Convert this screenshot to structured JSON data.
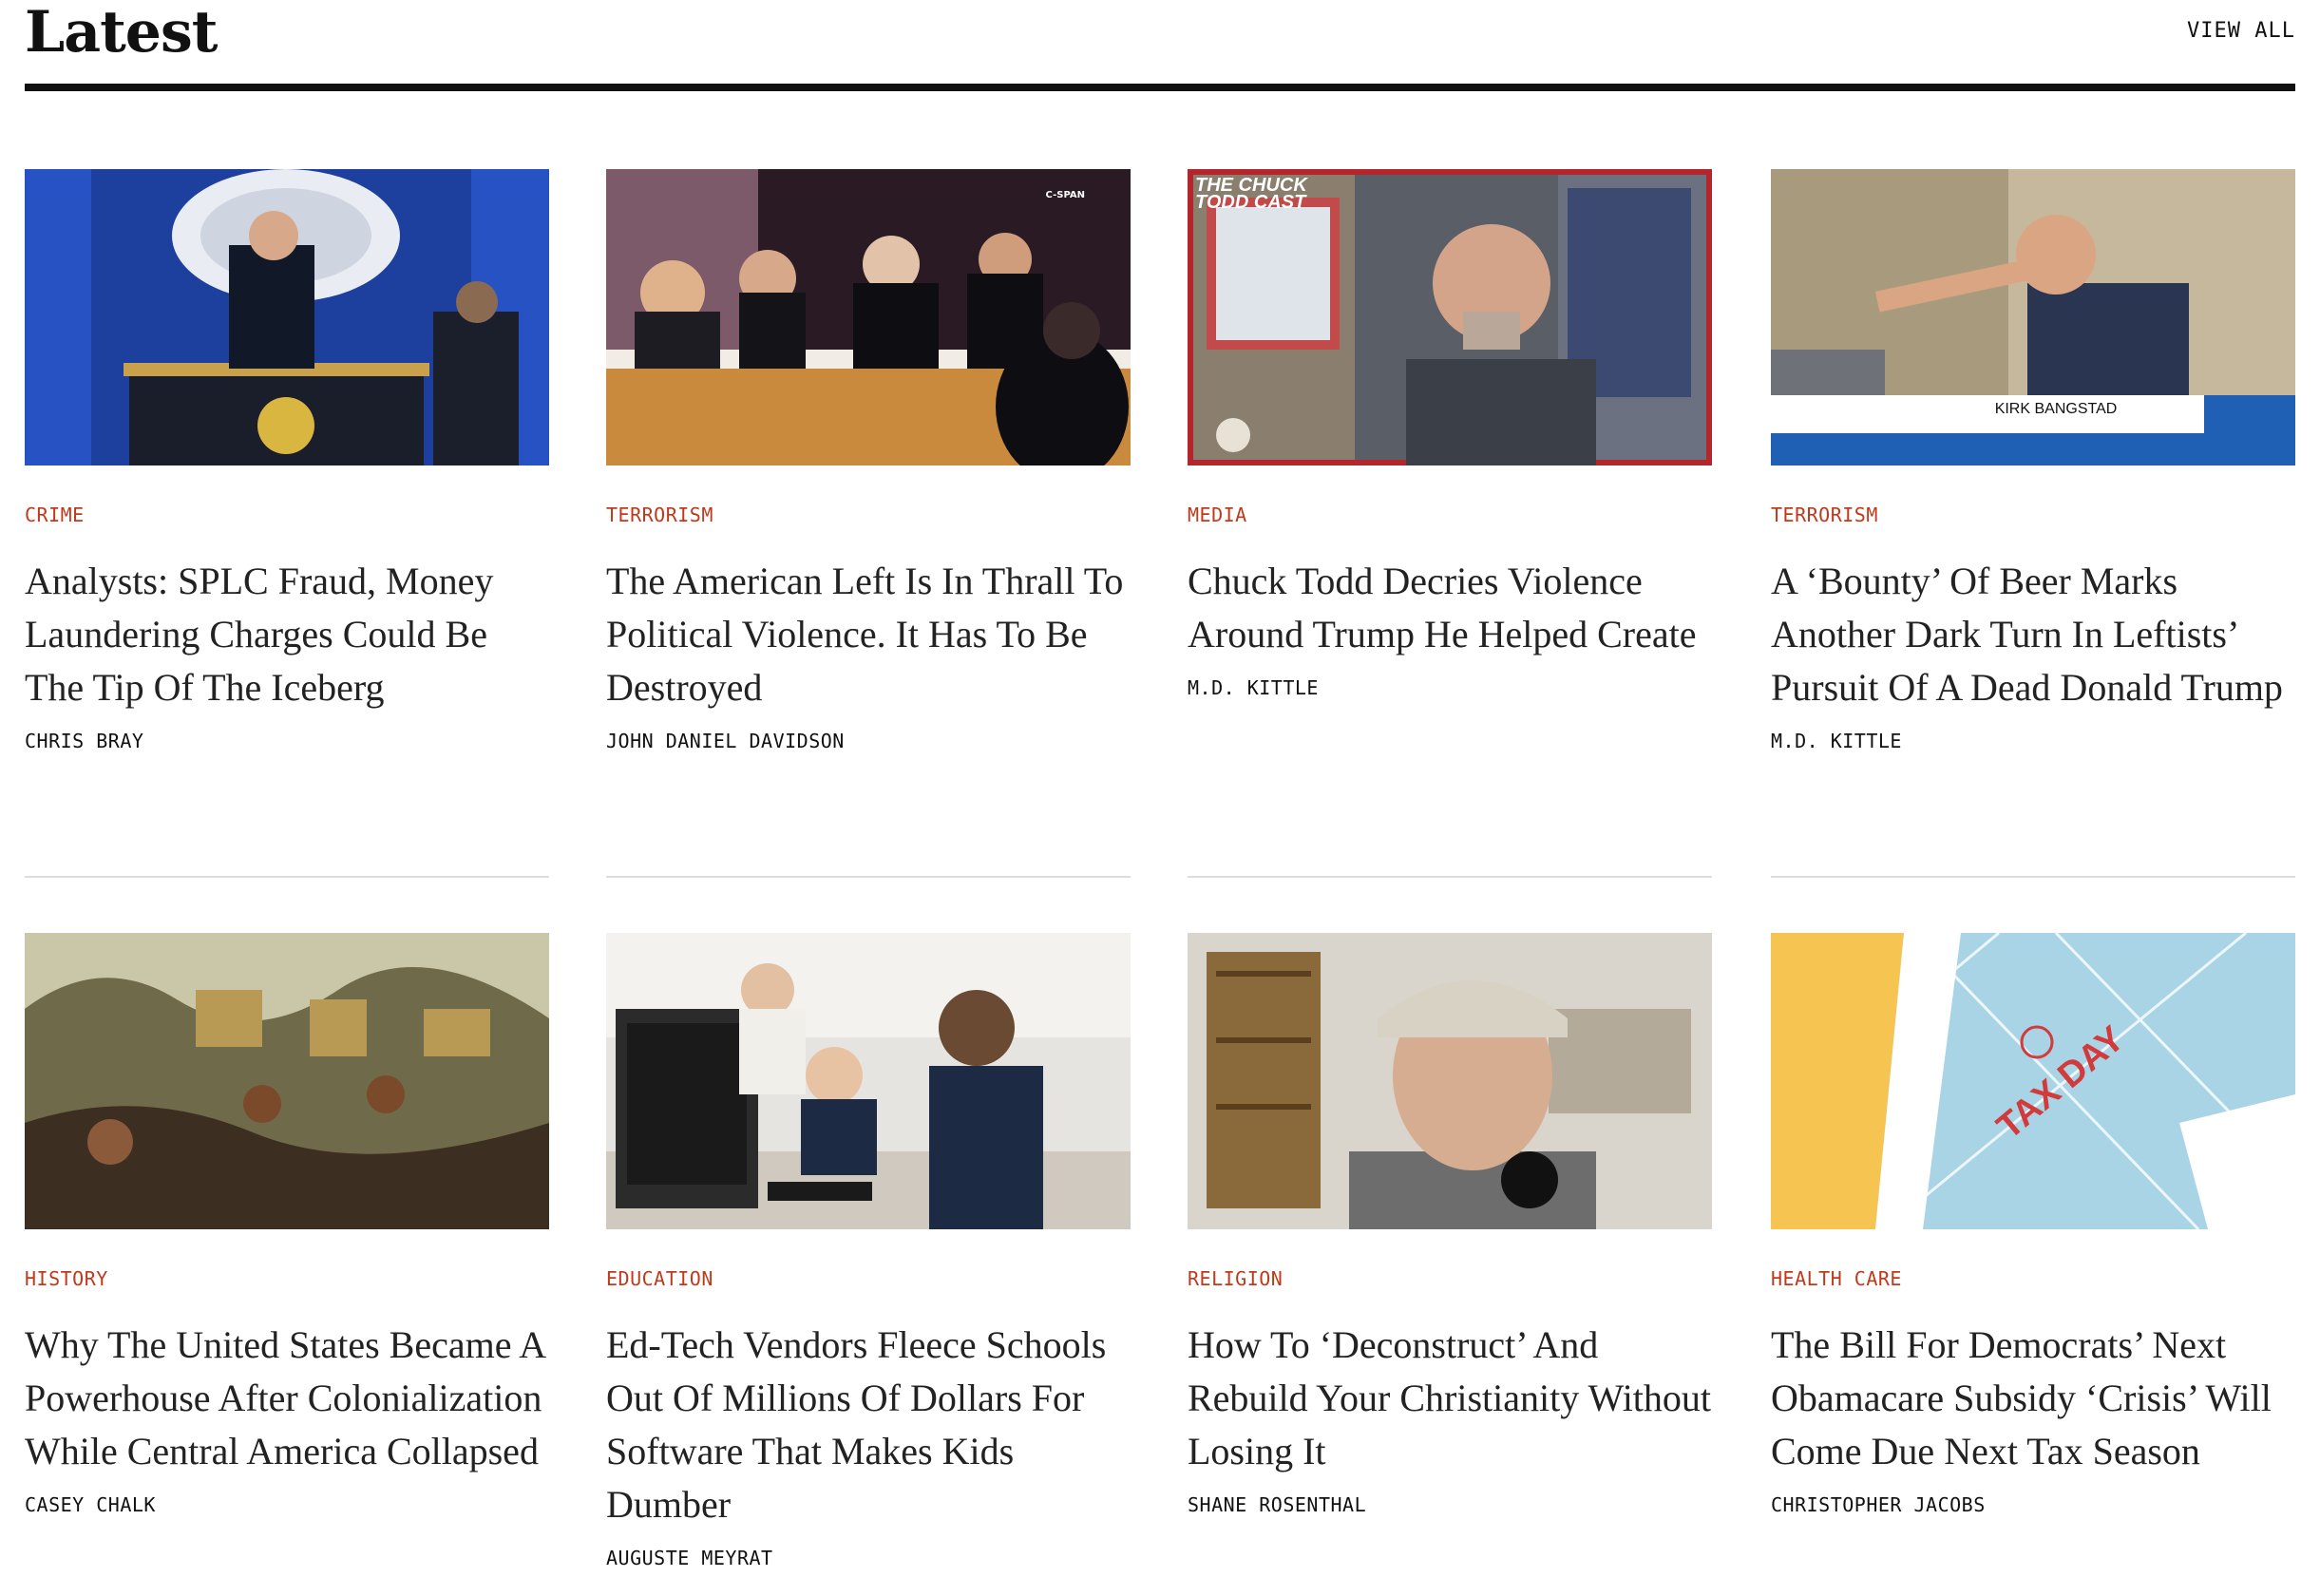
{
  "section": {
    "title": "Latest",
    "view_all": "VIEW ALL"
  },
  "articles": [
    {
      "category": "CRIME",
      "headline": "Analysts: SPLC Fraud, Money Laundering Charges Could Be The Tip Of The Iceberg",
      "author": "CHRIS BRAY",
      "thumb": {
        "bg": "#1d3f9e",
        "accent": "#d9b640",
        "figure": "#111827",
        "overlay_text": ""
      }
    },
    {
      "category": "TERRORISM",
      "headline": "The American Left Is In Thrall To Political Violence. It Has To Be Destroyed",
      "author": "JOHN DANIEL DAVIDSON",
      "thumb": {
        "bg": "#2a1a24",
        "accent": "#c98a3d",
        "figure": "#0d0d12",
        "overlay_text": "C-SPAN"
      }
    },
    {
      "category": "MEDIA",
      "headline": "Chuck Todd Decries Violence Around Trump He Helped Create",
      "author": "M.D. KITTLE",
      "thumb": {
        "bg": "#5a5e66",
        "accent": "#b4262b",
        "figure": "#3b4048",
        "overlay_text": ""
      }
    },
    {
      "category": "TERRORISM",
      "headline": "A ‘Bounty’ Of Beer Marks Another Dark Turn In Leftists’ Pursuit Of A Dead Donald Trump",
      "author": "M.D. KITTLE",
      "thumb": {
        "bg": "#a89a7c",
        "accent": "#1f5fb4",
        "figure": "#2a3552",
        "overlay_text": "KIRK BANGSTAD"
      }
    },
    {
      "category": "HISTORY",
      "headline": "Why The United States Became A Powerhouse After Colonialization While Central America Collapsed",
      "author": "CASEY CHALK",
      "thumb": {
        "bg": "#6e6a4a",
        "accent": "#b89a55",
        "figure": "#3d2e22",
        "overlay_text": ""
      }
    },
    {
      "category": "EDUCATION",
      "headline": "Ed-Tech Vendors Fleece Schools Out Of Millions Of Dollars For Software That Makes Kids Dumber",
      "author": "AUGUSTE MEYRAT",
      "thumb": {
        "bg": "#e6e4e0",
        "accent": "#1c2a44",
        "figure": "#2b2b2b",
        "overlay_text": ""
      }
    },
    {
      "category": "RELIGION",
      "headline": "How To ‘Deconstruct’ And Rebuild Your Christianity Without Losing It",
      "author": "SHANE ROSENTHAL",
      "thumb": {
        "bg": "#d9d4cc",
        "accent": "#8a6a3a",
        "figure": "#6d6d6d",
        "overlay_text": ""
      }
    },
    {
      "category": "HEALTH CARE",
      "headline": "The Bill For Democrats’ Next Obamacare Subsidy ‘Crisis’ Will Come Due Next Tax Season",
      "author": "CHRISTOPHER JACOBS",
      "thumb": {
        "bg": "#a8d4e6",
        "accent": "#f5c451",
        "figure": "#d23b3b",
        "overlay_text": "TAX DAY"
      }
    }
  ]
}
